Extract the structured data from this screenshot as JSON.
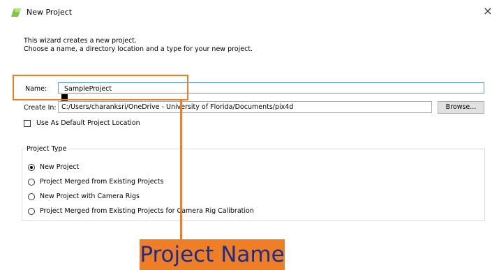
{
  "window": {
    "title": "New Project",
    "close_glyph": "×"
  },
  "description": {
    "line1": "This wizard creates a new project.",
    "line2": "Choose a name, a directory location and a type for your new project."
  },
  "form": {
    "name_label": "Name:",
    "name_value": "SampleProject",
    "create_in_label": "Create In:",
    "create_in_value": "C:/Users/charanksri/OneDrive - University of Florida/Documents/pix4d",
    "browse_label": "Browse...",
    "default_location_label": "Use As Default Project Location",
    "default_location_checked": false
  },
  "project_type": {
    "title": "Project Type",
    "options": [
      {
        "label": "New Project",
        "selected": true
      },
      {
        "label": "Project Merged from Existing Projects",
        "selected": false
      },
      {
        "label": "New Project with Camera Rigs",
        "selected": false
      },
      {
        "label": "Project Merged from Existing Projects for Camera Rig Calibration",
        "selected": false
      }
    ]
  },
  "annotation": {
    "label": "Project Name",
    "color": "#ef7f27",
    "text_color": "#1f2d8a"
  },
  "icons": {
    "app": "pix4d-app-icon",
    "close": "close-icon"
  }
}
